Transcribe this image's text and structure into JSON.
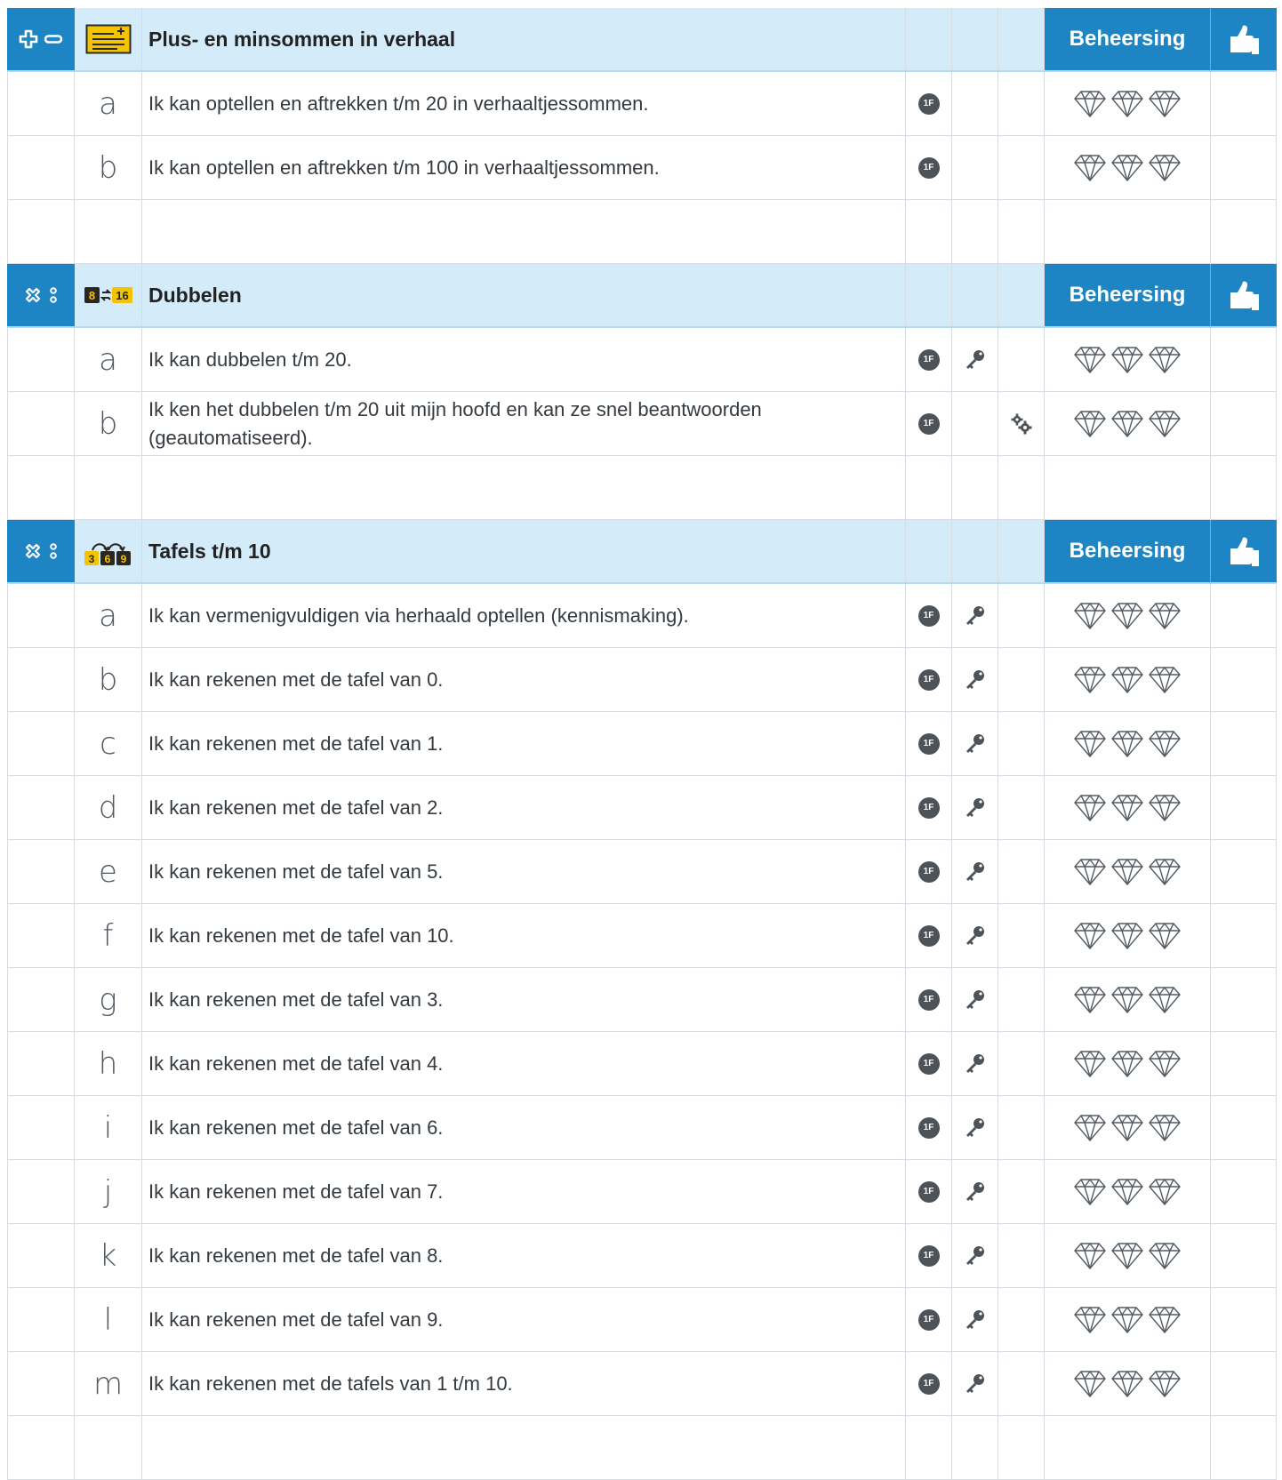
{
  "sections": [
    {
      "category_icons": [
        "plus-icon",
        "minus-icon"
      ],
      "topic_icon": "story-sum-icon",
      "title": "Plus- en minsommen in verhaal",
      "mastery_label": "Beheersing",
      "thumb_icon": "thumbs-up-icon",
      "items": [
        {
          "letter": "a",
          "text": "Ik kan optellen en aftrekken t/m 20 in verhaaltjessommen.",
          "level": "1F",
          "key": false,
          "automated": false
        },
        {
          "letter": "b",
          "text": "Ik kan optellen en aftrekken t/m 100 in verhaaltjessommen.",
          "level": "1F",
          "key": false,
          "automated": false
        }
      ]
    },
    {
      "category_icons": [
        "multiply-icon",
        "divide-icon"
      ],
      "topic_icon": "doubling-icon",
      "topic_icon_text": [
        "8",
        "16"
      ],
      "title": "Dubbelen",
      "mastery_label": "Beheersing",
      "thumb_icon": "thumbs-up-icon",
      "items": [
        {
          "letter": "a",
          "text": "Ik kan dubbelen t/m 20.",
          "level": "1F",
          "key": true,
          "automated": false
        },
        {
          "letter": "b",
          "text": "Ik ken het dubbelen t/m 20 uit mijn hoofd en kan ze snel beantwoorden (geautomatiseerd).",
          "level": "1F",
          "key": false,
          "automated": true
        }
      ]
    },
    {
      "category_icons": [
        "multiply-icon",
        "divide-icon"
      ],
      "topic_icon": "times-table-icon",
      "topic_icon_text": [
        "3",
        "6",
        "9"
      ],
      "title": "Tafels t/m 10",
      "mastery_label": "Beheersing",
      "thumb_icon": "thumbs-up-icon",
      "items": [
        {
          "letter": "a",
          "text": "Ik kan vermenigvuldigen via herhaald optellen (kennismaking).",
          "level": "1F",
          "key": true,
          "automated": false
        },
        {
          "letter": "b",
          "text": "Ik kan rekenen met de tafel van 0.",
          "level": "1F",
          "key": true,
          "automated": false
        },
        {
          "letter": "c",
          "text": "Ik kan rekenen met de tafel van 1.",
          "level": "1F",
          "key": true,
          "automated": false
        },
        {
          "letter": "d",
          "text": "Ik kan rekenen met de tafel van 2.",
          "level": "1F",
          "key": true,
          "automated": false
        },
        {
          "letter": "e",
          "text": "Ik kan rekenen met de tafel van 5.",
          "level": "1F",
          "key": true,
          "automated": false
        },
        {
          "letter": "f",
          "text": "Ik kan rekenen met de tafel van 10.",
          "level": "1F",
          "key": true,
          "automated": false
        },
        {
          "letter": "g",
          "text": "Ik kan rekenen met de tafel van 3.",
          "level": "1F",
          "key": true,
          "automated": false
        },
        {
          "letter": "h",
          "text": "Ik kan rekenen met de tafel van 4.",
          "level": "1F",
          "key": true,
          "automated": false
        },
        {
          "letter": "i",
          "text": "Ik kan rekenen met de tafel van 6.",
          "level": "1F",
          "key": true,
          "automated": false
        },
        {
          "letter": "j",
          "text": "Ik kan rekenen met de tafel van 7.",
          "level": "1F",
          "key": true,
          "automated": false
        },
        {
          "letter": "k",
          "text": "Ik kan rekenen met de tafel van 8.",
          "level": "1F",
          "key": true,
          "automated": false
        },
        {
          "letter": "l",
          "text": "Ik kan rekenen met de tafel van 9.",
          "level": "1F",
          "key": true,
          "automated": false
        },
        {
          "letter": "m",
          "text": "Ik kan rekenen met de tafels van 1 t/m 10.",
          "level": "1F",
          "key": true,
          "automated": false
        }
      ]
    }
  ],
  "gems_per_row": 3,
  "colors": {
    "header_blue": "#1e85c4",
    "header_light": "#d4ecf9",
    "grid": "#d6dce2",
    "badge": "#4d5359",
    "icon_yellow": "#f5c400"
  }
}
